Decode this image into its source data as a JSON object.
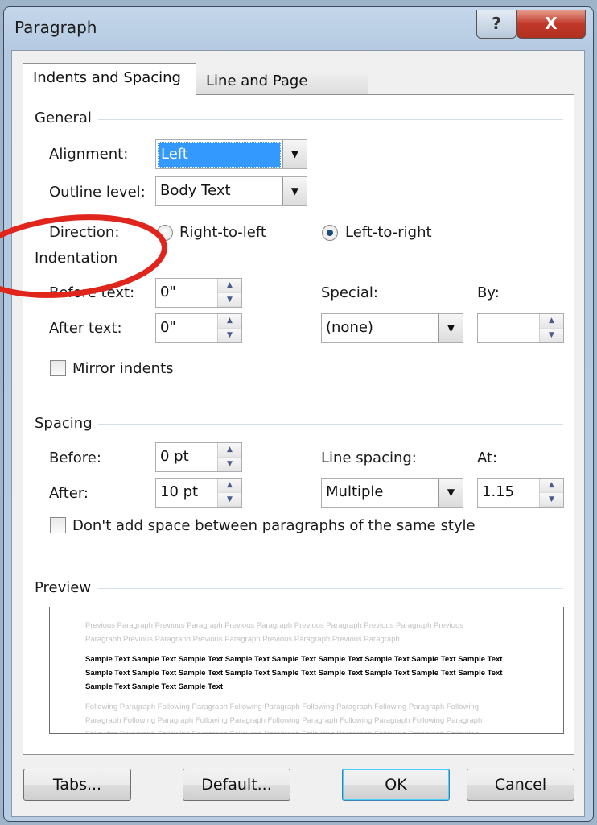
{
  "window": {
    "title": "Paragraph",
    "help_label": "?",
    "close_label": "X"
  },
  "tabs": [
    {
      "label": "Indents and Spacing",
      "active": true
    },
    {
      "label": "Line and Page Breaks",
      "active": false
    }
  ],
  "general": {
    "heading": "General",
    "alignment_label": "Alignment:",
    "alignment_value": "Left",
    "outline_label": "Outline level:",
    "outline_value": "Body Text",
    "direction_label": "Direction:",
    "rtl_label": "Right-to-left",
    "ltr_label": "Left-to-right",
    "direction_selected": "Left-to-right"
  },
  "indentation": {
    "heading": "Indentation",
    "before_label": "Before text:",
    "before_value": "0\"",
    "after_label": "After text:",
    "after_value": "0\"",
    "special_label": "Special:",
    "special_value": "(none)",
    "by_label": "By:",
    "by_value": "",
    "mirror_label": "Mirror indents",
    "mirror_checked": false
  },
  "spacing": {
    "heading": "Spacing",
    "before_label": "Before:",
    "before_value": "0 pt",
    "after_label": "After:",
    "after_value": "10 pt",
    "line_spacing_label": "Line spacing:",
    "line_spacing_value": "Multiple",
    "at_label": "At:",
    "at_value": "1.15",
    "dont_add_label": "Don't add space between paragraphs of the same style",
    "dont_add_checked": false
  },
  "preview": {
    "heading": "Preview",
    "previous": "Previous Paragraph Previous Paragraph Previous Paragraph Previous Paragraph Previous Paragraph Previous Paragraph Previous Paragraph Previous Paragraph Previous Paragraph Previous Paragraph",
    "sample": "Sample Text Sample Text Sample Text Sample Text Sample Text Sample Text Sample Text Sample Text Sample Text Sample Text Sample Text Sample Text Sample Text Sample Text Sample Text Sample Text Sample Text Sample Text Sample Text Sample Text Sample Text",
    "following": "Following Paragraph Following Paragraph Following Paragraph Following Paragraph Following Paragraph Following Paragraph Following Paragraph Following Paragraph Following Paragraph Following Paragraph Following Paragraph Following Paragraph Following Paragraph Following Paragraph Following Paragraph Following Paragraph Following Paragraph"
  },
  "buttons": {
    "tabs": "Tabs...",
    "default": "Default...",
    "ok": "OK",
    "cancel": "Cancel"
  },
  "annotation": {
    "color": "#e0261c"
  }
}
